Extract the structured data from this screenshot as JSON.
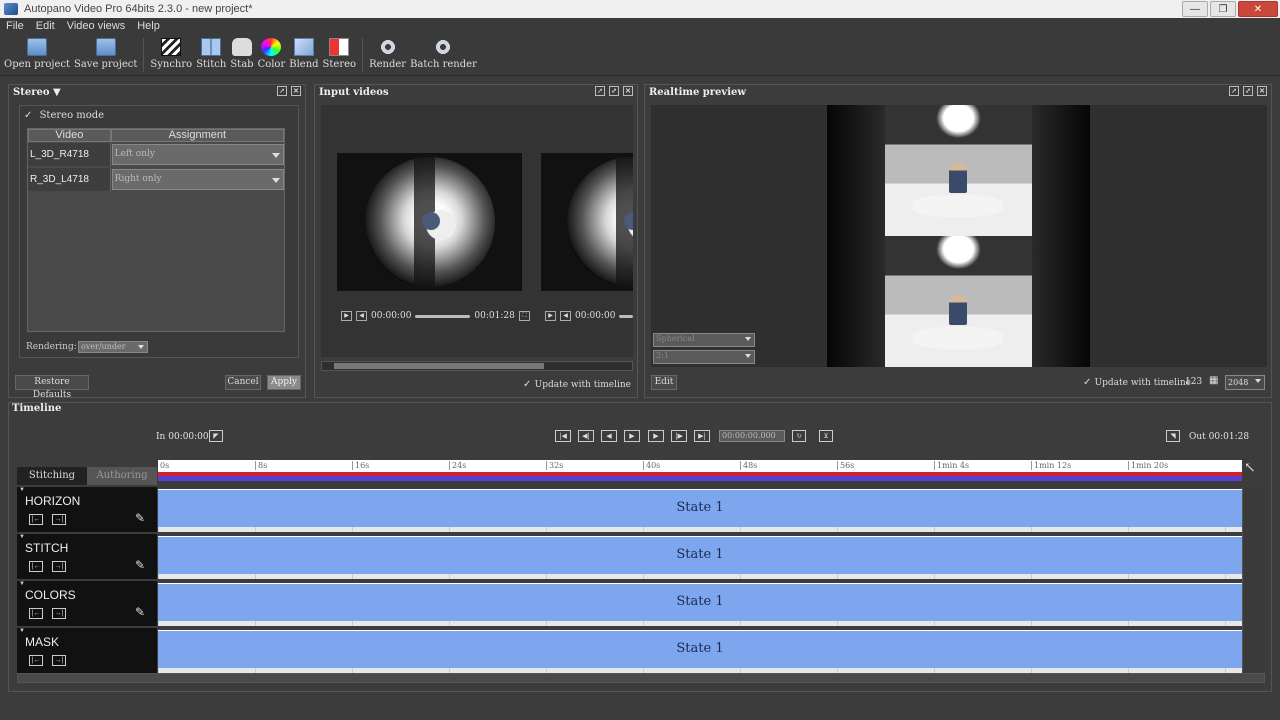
{
  "window": {
    "title": "Autopano Video Pro 64bits 2.3.0 - new project*",
    "minimize": "—",
    "restore": "❐",
    "close": "✕"
  },
  "menu": [
    "File",
    "Edit",
    "Video views",
    "Help"
  ],
  "toolbar": {
    "open_project": "Open project",
    "save_project": "Save project",
    "synchro": "Synchro",
    "stitch": "Stitch",
    "stab": "Stab",
    "color": "Color",
    "blend": "Blend",
    "stereo": "Stereo",
    "render": "Render",
    "batch_render": "Batch render"
  },
  "stereo_panel": {
    "title": "Stereo ▼",
    "stereo_mode_label": "Stereo mode",
    "col_video": "Video",
    "col_assignment": "Assignment",
    "rows": [
      {
        "video": "L_3D_R4718",
        "assignment": "Left only"
      },
      {
        "video": "R_3D_L4718",
        "assignment": "Right only"
      }
    ],
    "rendering_label": "Rendering:",
    "rendering_value": "over/under",
    "restore_defaults": "Restore Defaults",
    "cancel": "Cancel",
    "apply": "Apply"
  },
  "input_videos": {
    "title": "Input videos",
    "video1_time_start": "00:00:00",
    "video1_time_end": "00:01:28",
    "video2_time_start": "00:00:00",
    "update_with_timeline": "Update with timeline"
  },
  "preview": {
    "title": "Realtime preview",
    "projection": "Spherical",
    "ratio": "2:1",
    "edit": "Edit",
    "update_with_timeline": "Update with timeline",
    "count": "123",
    "resolution": "2048"
  },
  "timeline": {
    "title": "Timeline",
    "in_label": "In 00:00:00",
    "out_label": "Out 00:01:28",
    "timecode": "00:00:00.000",
    "tab_stitching": "Stitching",
    "tab_authoring": "Authoring",
    "ruler": [
      "0s",
      "8s",
      "16s",
      "24s",
      "32s",
      "40s",
      "48s",
      "56s",
      "1min 4s",
      "1min 12s",
      "1min 20s"
    ],
    "tracks": [
      {
        "name": "HORIZON",
        "state": "State 1"
      },
      {
        "name": "STITCH",
        "state": "State 1"
      },
      {
        "name": "COLORS",
        "state": "State 1"
      },
      {
        "name": "MASK",
        "state": "State 1"
      }
    ]
  },
  "colors": {
    "state_fill": "#7ea6ef",
    "playhead_bar": "#cc2233",
    "selection_bar": "#5b3fd0"
  }
}
